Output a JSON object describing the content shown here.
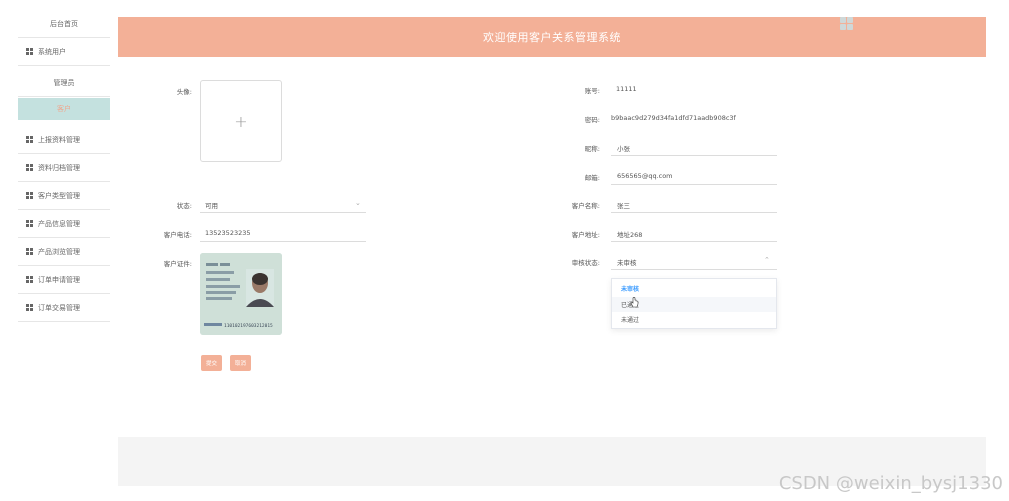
{
  "sidebar": {
    "items": [
      {
        "label": "后台首页"
      },
      {
        "label": "系统用户"
      },
      {
        "label": "管理员"
      },
      {
        "label": "客户"
      },
      {
        "label": "上报资料管理"
      },
      {
        "label": "资料归档管理"
      },
      {
        "label": "客户类型管理"
      },
      {
        "label": "产品信息管理"
      },
      {
        "label": "产品浏览管理"
      },
      {
        "label": "订单申请管理"
      },
      {
        "label": "订单交易管理"
      }
    ]
  },
  "header": {
    "title": "欢迎使用客户关系管理系统",
    "icon": "grid-icon"
  },
  "form": {
    "avatar_label": "头像:",
    "status_label": "状态:",
    "status_value": "可用",
    "phone_label": "客户电话:",
    "phone_value": "13523523235",
    "idcard_label": "客户证件:",
    "account_label": "账号:",
    "account_value": "11111",
    "password_label": "密码:",
    "password_value": "b9baac9d279d34fa1dfd71aadb908c3f",
    "nickname_label": "昵称:",
    "nickname_value": "小张",
    "email_label": "邮箱:",
    "email_value": "656565@qq.com",
    "customer_name_label": "客户名称:",
    "customer_name_value": "张三",
    "address_label": "客户地址:",
    "address_value": "地址268",
    "review_label": "审核状态:",
    "review_value": "未审核"
  },
  "dropdown": {
    "options": [
      "未审核",
      "已通过",
      "未通过"
    ],
    "selected": "未审核"
  },
  "buttons": {
    "submit": "提交",
    "cancel": "取消"
  },
  "idcard_image": {
    "number": "110102197603212015"
  },
  "watermark": "CSDN @weixin_bysj1330",
  "colors": {
    "header_bg": "#f3b097",
    "active_item_bg": "#c4e1df",
    "accent_text": "#409eff"
  }
}
